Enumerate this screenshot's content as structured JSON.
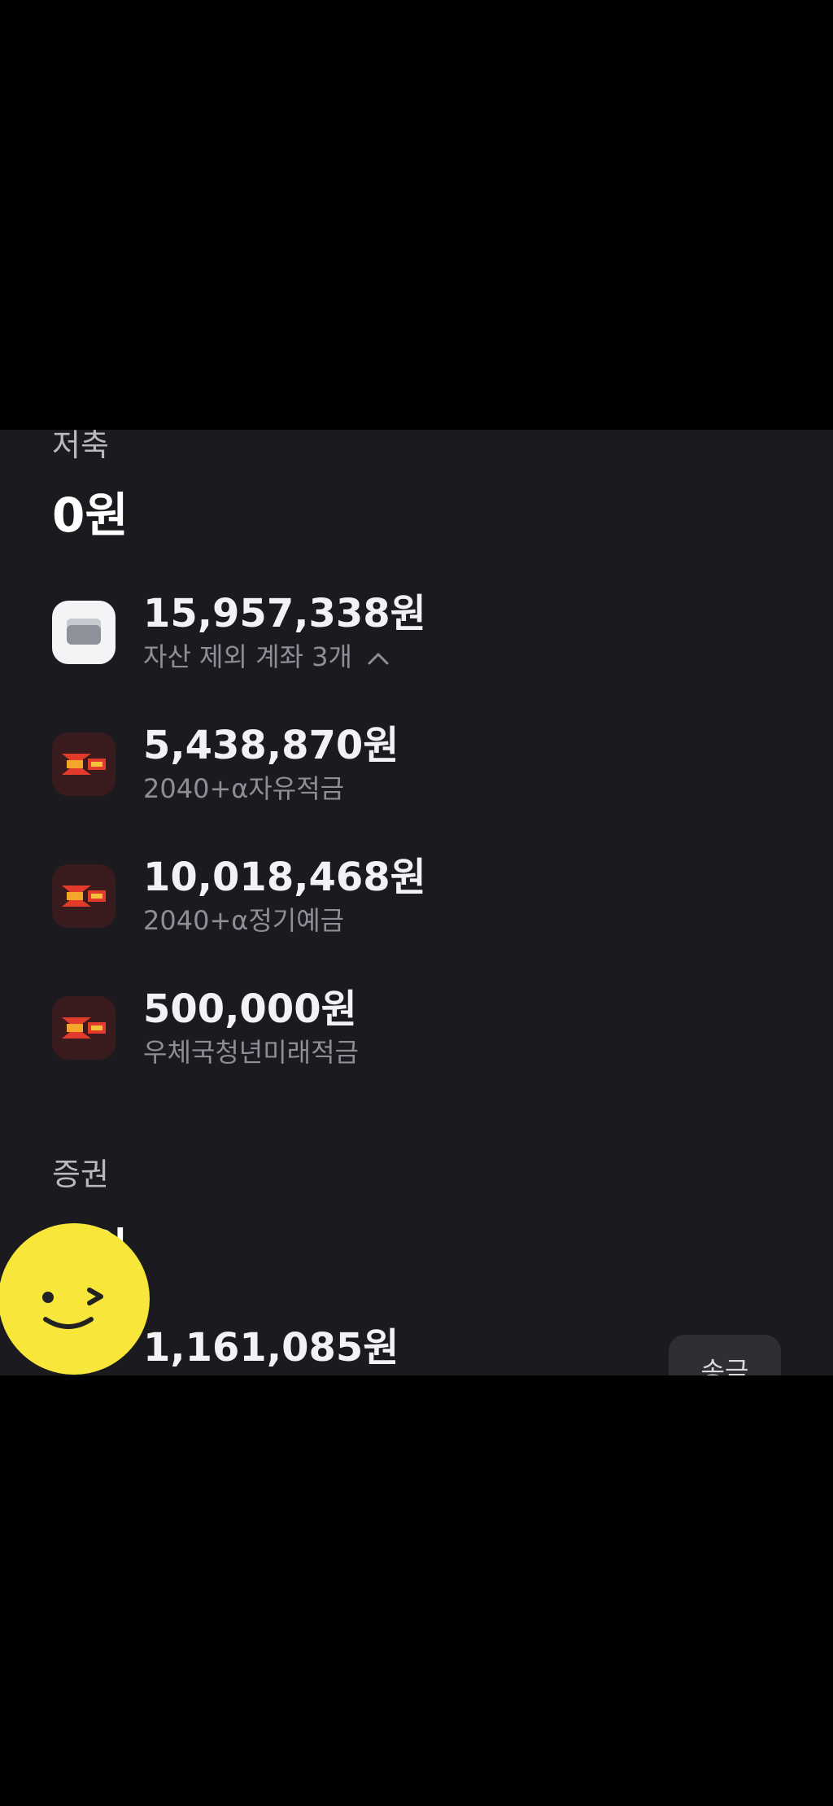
{
  "savings": {
    "label": "저축",
    "total": "0원",
    "accounts": [
      {
        "amount": "15,957,338원",
        "name": "자산 제외 계좌 3개",
        "icon": "card-icon",
        "icon_bg": "#f4f4f6"
      },
      {
        "amount": "5,438,870원",
        "name": "2040+α자유적금",
        "icon": "bank-logo-icon",
        "icon_bg": "#3a1b1d"
      },
      {
        "amount": "10,018,468원",
        "name": "2040+α정기예금",
        "icon": "bank-logo-icon",
        "icon_bg": "#3a1b1d"
      },
      {
        "amount": "500,000원",
        "name": "우체국청년미래적금",
        "icon": "bank-logo-icon",
        "icon_bg": "#3a1b1d"
      }
    ]
  },
  "securities": {
    "label": "증권",
    "total_partial": "0원",
    "accounts": [
      {
        "amount": "1,161,085원",
        "button": "송금"
      }
    ]
  },
  "colors": {
    "background": "#1b1b1f",
    "primary_text": "#f2f2f5",
    "secondary_text": "#8d8f98",
    "floating_button": "#f8e63a"
  }
}
